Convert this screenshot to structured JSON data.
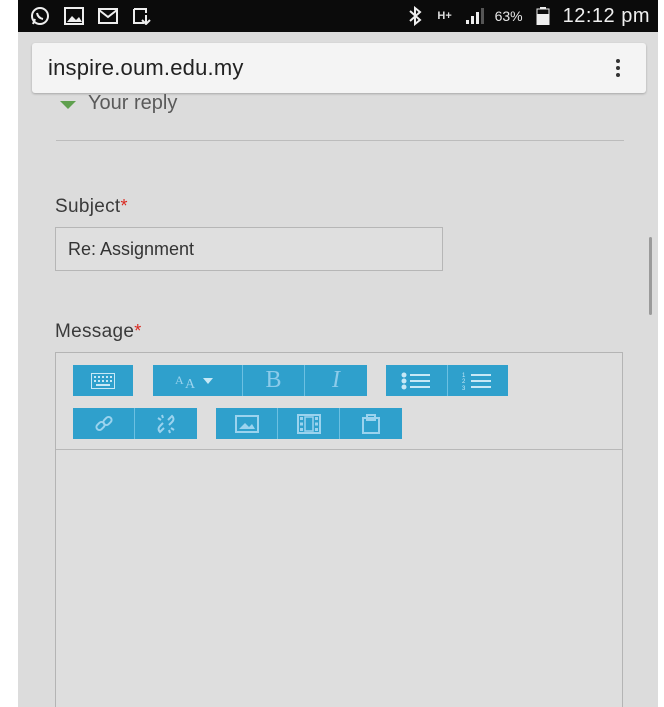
{
  "status_bar": {
    "icons": [
      "whatsapp-icon",
      "gallery-icon",
      "mail-icon",
      "download-icon"
    ],
    "right_icons": [
      "bluetooth-icon",
      "data-ht-icon",
      "signal-icon"
    ],
    "network_type": "H+",
    "battery_percent": "63%",
    "time": "12:12 pm"
  },
  "browser": {
    "url": "inspire.oum.edu.my"
  },
  "form": {
    "section_toggle": "Your reply",
    "subject_label": "Subject",
    "subject_value": "Re: Assignment",
    "message_label": "Message",
    "required_mark": "*"
  },
  "editor_toolbar": {
    "row1": [
      "toolbar-toggle",
      "font-color",
      "bold",
      "italic",
      "unordered-list",
      "ordered-list"
    ],
    "row2": [
      "link",
      "unlink",
      "image",
      "media",
      "paste"
    ],
    "bold_glyph": "B",
    "italic_glyph": "I"
  },
  "colors": {
    "accent": "#2fa0cc",
    "required": "#d9281f",
    "caret": "#5fa04e"
  }
}
